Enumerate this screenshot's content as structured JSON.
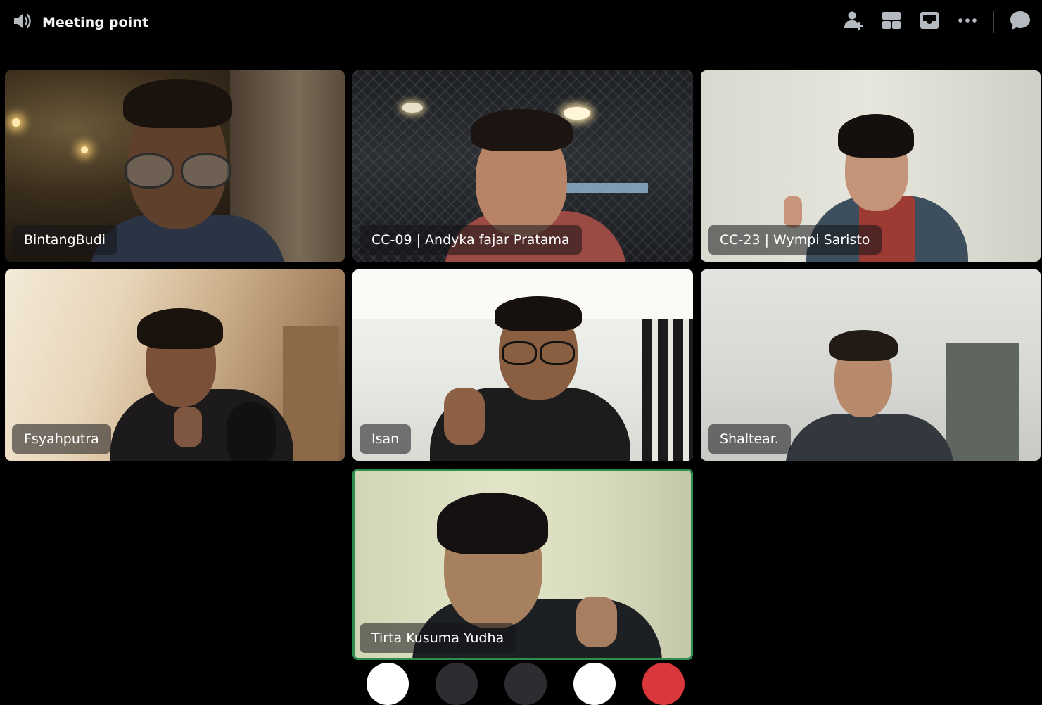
{
  "header": {
    "channel_title": "Meeting point",
    "icons": [
      "speaker-icon",
      "add-person-icon",
      "layout-grid-icon",
      "inbox-icon",
      "more-icon",
      "chat-bubble-icon"
    ]
  },
  "participants": [
    {
      "name": "BintangBudi",
      "speaking": false
    },
    {
      "name": "CC-09 | Andyka fajar Pratama",
      "speaking": false
    },
    {
      "name": "CC-23 | Wympi Saristo",
      "speaking": false
    },
    {
      "name": "Fsyahputra",
      "speaking": false
    },
    {
      "name": "Isan",
      "speaking": false
    },
    {
      "name": "Shaltear.",
      "speaking": false
    },
    {
      "name": "Tirta Kusuma Yudha",
      "speaking": true
    }
  ],
  "colors": {
    "background": "#000000",
    "speaking_border": "#23a55a",
    "leave_button": "#da373c"
  }
}
